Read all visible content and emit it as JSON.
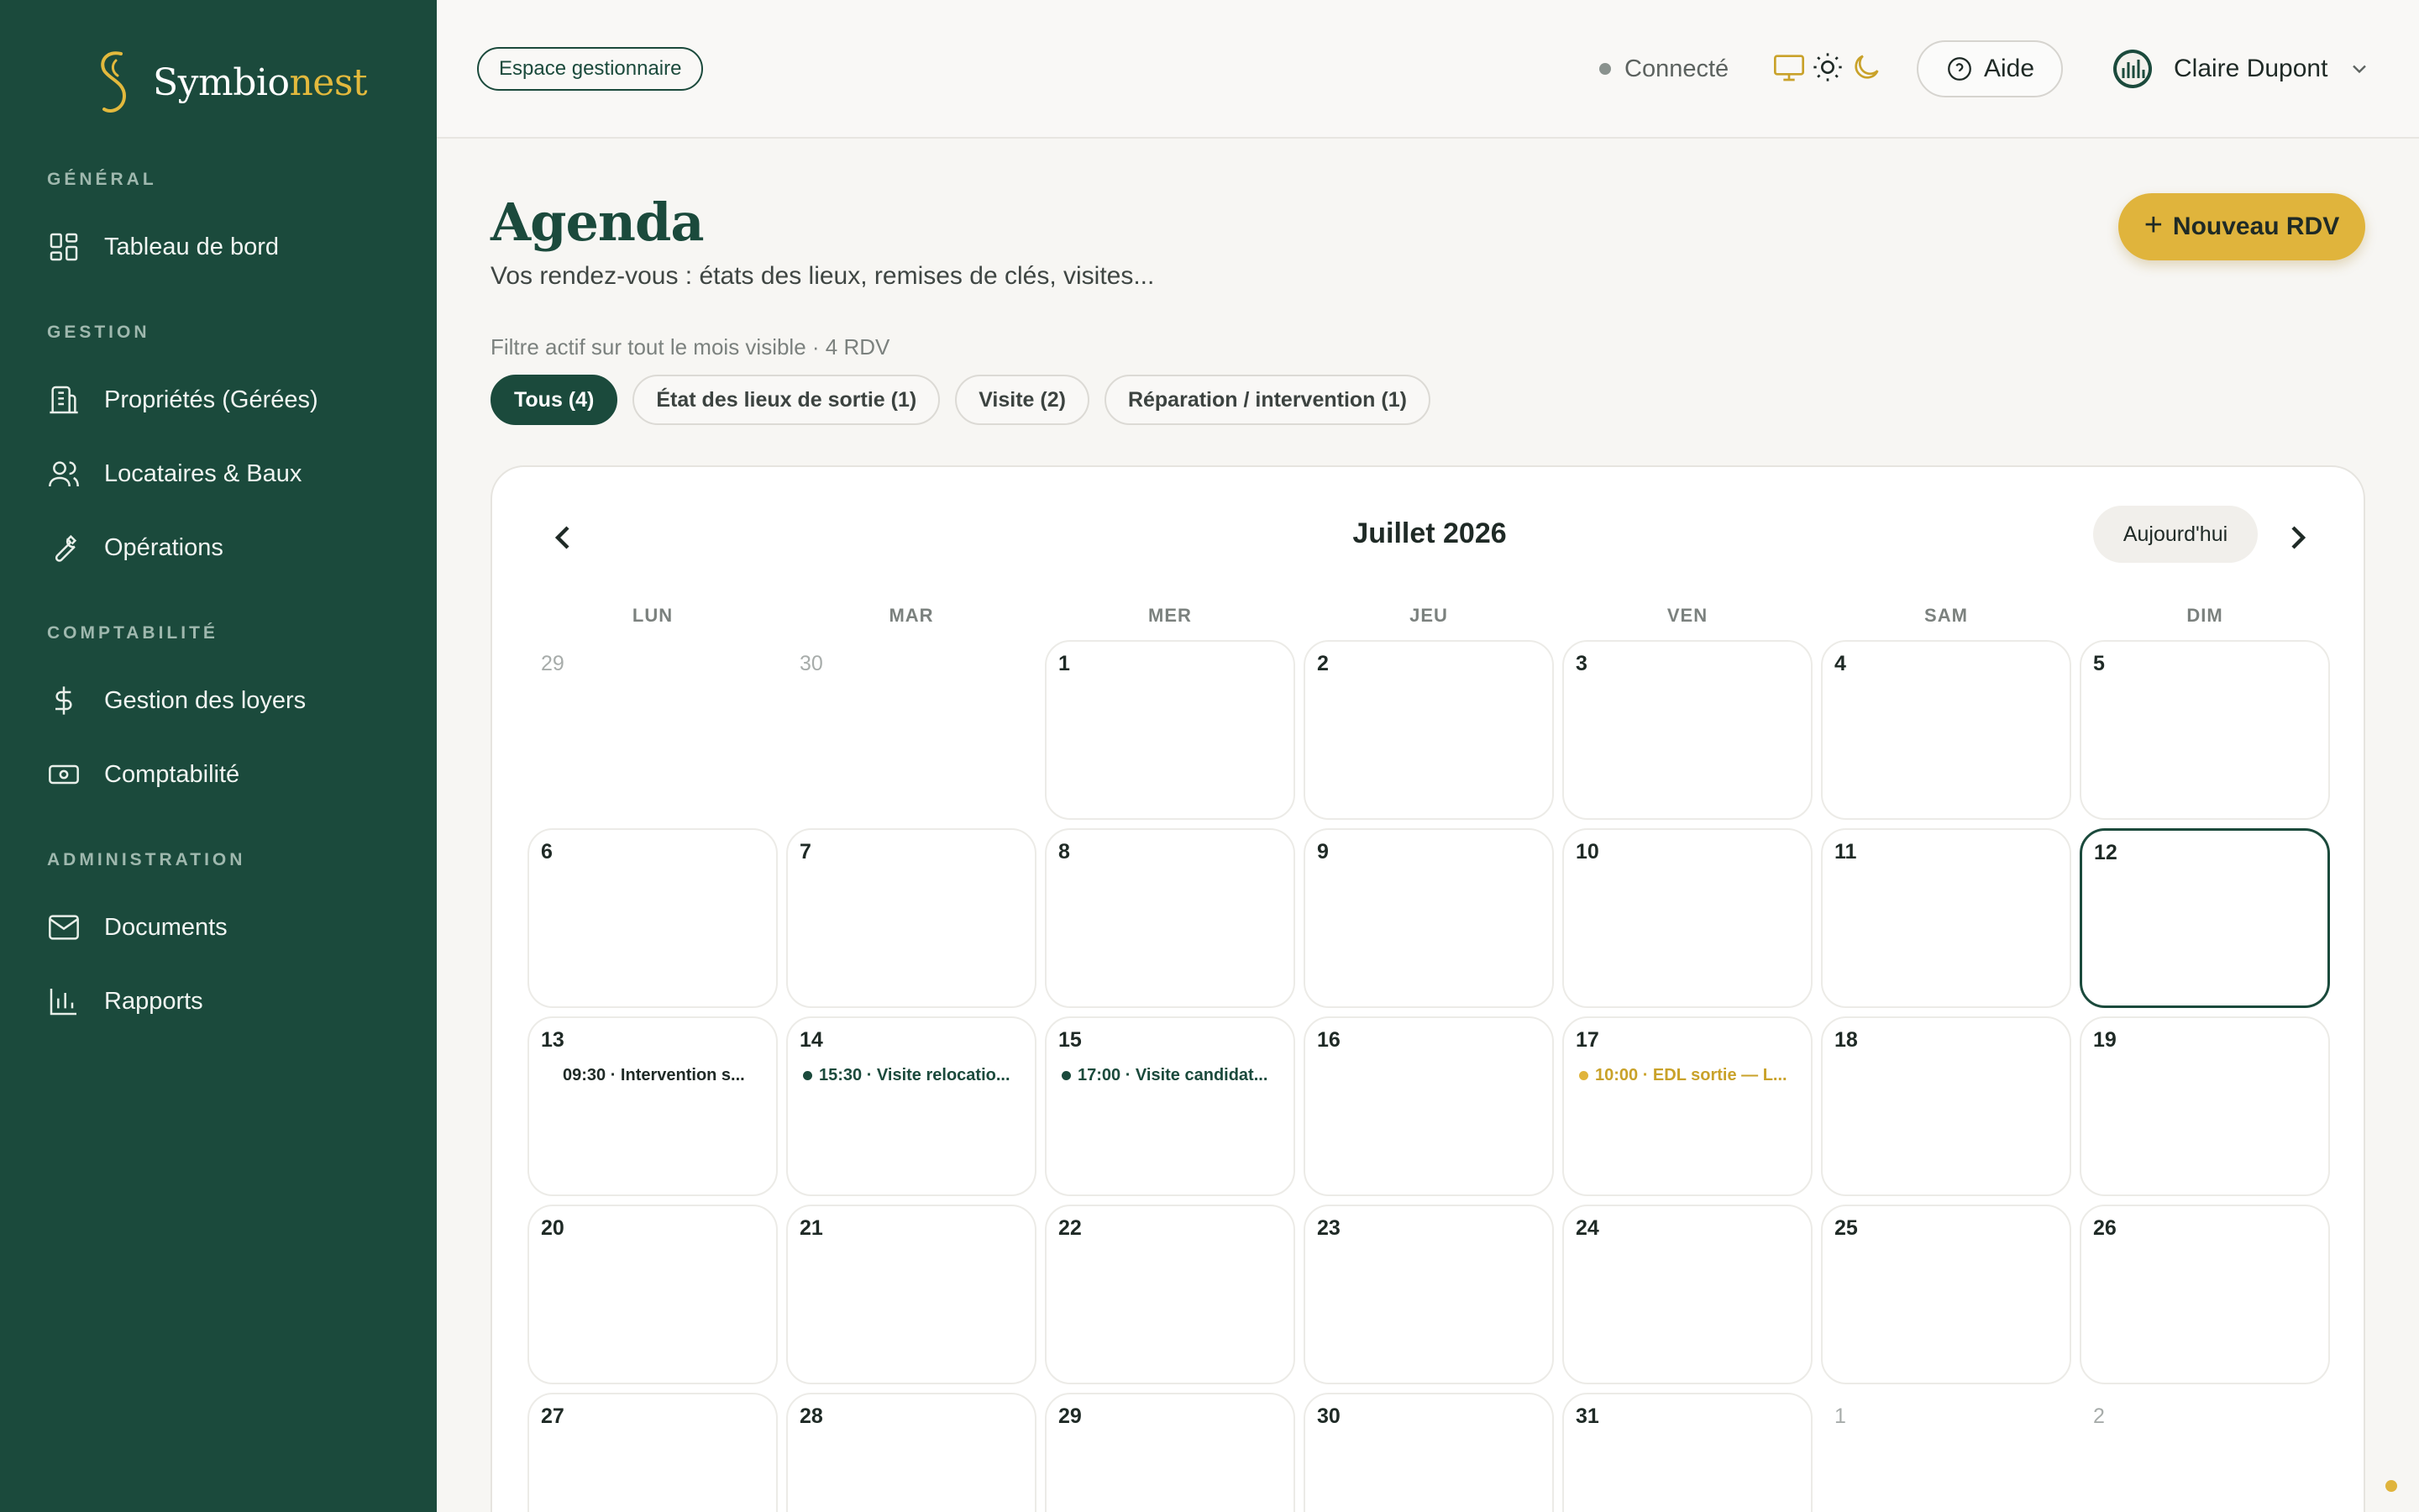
{
  "brand": {
    "name_main": "Symbio",
    "name_accent": "nest"
  },
  "sidebar": {
    "sections": [
      {
        "title": "GÉNÉRAL",
        "items": [
          {
            "label": "Tableau de bord",
            "icon": "dashboard-icon"
          }
        ]
      },
      {
        "title": "GESTION",
        "items": [
          {
            "label": "Propriétés (Gérées)",
            "icon": "building-icon"
          },
          {
            "label": "Locataires & Baux",
            "icon": "users-icon"
          },
          {
            "label": "Opérations",
            "icon": "wrench-icon"
          }
        ]
      },
      {
        "title": "COMPTABILITÉ",
        "items": [
          {
            "label": "Gestion des loyers",
            "icon": "dollar-icon"
          },
          {
            "label": "Comptabilité",
            "icon": "banknote-icon"
          }
        ]
      },
      {
        "title": "ADMINISTRATION",
        "items": [
          {
            "label": "Documents",
            "icon": "mail-icon"
          },
          {
            "label": "Rapports",
            "icon": "bar-chart-icon"
          }
        ]
      }
    ]
  },
  "topbar": {
    "space_label": "Espace gestionnaire",
    "status": "Connecté",
    "help_label": "Aide",
    "user_name": "Claire Dupont"
  },
  "page": {
    "title": "Agenda",
    "subtitle": "Vos rendez-vous : états des lieux, remises de clés, visites...",
    "new_button": "Nouveau RDV",
    "filter_note": "Filtre actif sur tout le mois visible · 4 RDV",
    "filters": [
      {
        "label": "Tous (4)",
        "active": true
      },
      {
        "label": "État des lieux de sortie (1)",
        "active": false
      },
      {
        "label": "Visite (2)",
        "active": false
      },
      {
        "label": "Réparation / intervention (1)",
        "active": false
      }
    ]
  },
  "calendar": {
    "month_label": "Juillet 2026",
    "today_label": "Aujourd'hui",
    "weekdays": [
      "LUN",
      "MAR",
      "MER",
      "JEU",
      "VEN",
      "SAM",
      "DIM"
    ],
    "weeks": [
      [
        {
          "n": "29",
          "outside": true
        },
        {
          "n": "30",
          "outside": true
        },
        {
          "n": "1"
        },
        {
          "n": "2"
        },
        {
          "n": "3"
        },
        {
          "n": "4"
        },
        {
          "n": "5"
        }
      ],
      [
        {
          "n": "6"
        },
        {
          "n": "7"
        },
        {
          "n": "8"
        },
        {
          "n": "9"
        },
        {
          "n": "10"
        },
        {
          "n": "11"
        },
        {
          "n": "12",
          "today": true
        }
      ],
      [
        {
          "n": "13",
          "event": {
            "text": "09:30 · Intervention s...",
            "color": "#1f2a26",
            "dot": ""
          }
        },
        {
          "n": "14",
          "event": {
            "text": "15:30 · Visite relocatio...",
            "color": "#1b4a3c",
            "dot": "#1b4a3c"
          }
        },
        {
          "n": "15",
          "event": {
            "text": "17:00 · Visite candidat...",
            "color": "#1b4a3c",
            "dot": "#1b4a3c"
          }
        },
        {
          "n": "16"
        },
        {
          "n": "17",
          "event": {
            "text": "10:00 · EDL sortie — L...",
            "color": "#c9a22a",
            "dot": "#e0b43c"
          }
        },
        {
          "n": "18"
        },
        {
          "n": "19"
        }
      ],
      [
        {
          "n": "20"
        },
        {
          "n": "21"
        },
        {
          "n": "22"
        },
        {
          "n": "23"
        },
        {
          "n": "24"
        },
        {
          "n": "25"
        },
        {
          "n": "26"
        }
      ],
      [
        {
          "n": "27"
        },
        {
          "n": "28"
        },
        {
          "n": "29"
        },
        {
          "n": "30"
        },
        {
          "n": "31"
        },
        {
          "n": "1",
          "outside": true
        },
        {
          "n": "2",
          "outside": true
        }
      ]
    ]
  },
  "colors": {
    "primary": "#1b4a3c",
    "accent": "#e0b43c",
    "background": "#f7f6f3"
  }
}
